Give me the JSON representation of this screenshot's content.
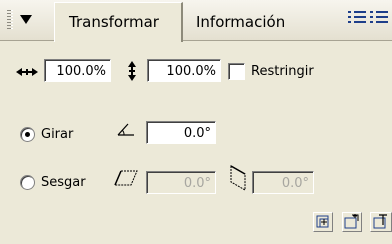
{
  "tabs": [
    {
      "label": "Transformar",
      "active": true
    },
    {
      "label": "Información",
      "active": false
    }
  ],
  "scale": {
    "width_value": "100.0%",
    "height_value": "100.0%",
    "constrain_label": "Restringir",
    "constrain_checked": false
  },
  "rotate": {
    "label": "Girar",
    "selected": true,
    "value": "0.0°"
  },
  "skew": {
    "label": "Sesgar",
    "selected": false,
    "horizontal_value": "0.0°",
    "vertical_value": "0.0°"
  },
  "icons": {
    "panel_menu": "triangle-down",
    "options": "list-options",
    "width": "horizontal-arrows",
    "height": "vertical-arrows",
    "rotate": "angle",
    "skew_h": "skew-horizontal",
    "skew_v": "skew-vertical",
    "copy_transform": "copy-transform",
    "create_transform": "create-transform",
    "reset_transform": "reset-transform"
  },
  "colors": {
    "panel_bg": "#ece9d8",
    "icon_blue": "#1e3f8a"
  }
}
